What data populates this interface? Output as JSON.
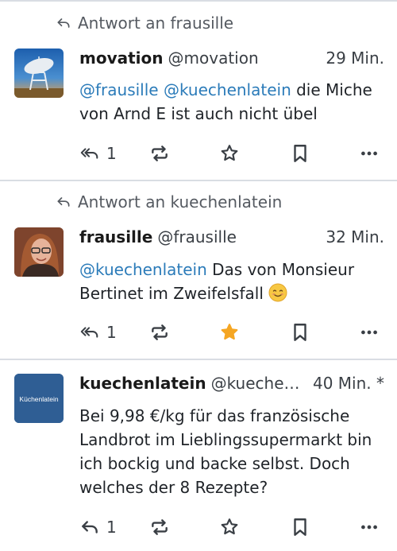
{
  "posts": [
    {
      "reply_to": "Antwort an frausille",
      "display_name": "movation",
      "handle": "@movation",
      "time": "29 Min.",
      "content_mentions": "@frausille @kuechenlatein",
      "content_text": " die Miche von Arnd E ist auch nicht übel",
      "reply_count": "1",
      "favourited": false,
      "avatar_icon": "satellite-dish"
    },
    {
      "reply_to": "Antwort an kuechenlatein",
      "display_name": "frausille",
      "handle": "@frausille",
      "time": "32 Min.",
      "content_mentions": "@kuechenlatein",
      "content_text": " Das von Monsieur Bertinet im Zweifelsfall",
      "content_emoji": "smiling-face",
      "reply_count": "1",
      "favourited": true,
      "avatar_icon": "person-photo"
    },
    {
      "display_name": "kuechenlatein",
      "handle": "@kuechenl…",
      "time": "40 Min. *",
      "content_text": "Bei 9,98 €/kg für das französische Landbrot im Lieblingssupermarkt bin ich bockig und backe selbst. Doch welches der 8 Rezepte?",
      "reply_count": "1",
      "favourited": false,
      "avatar_label": "Küchenlatein"
    }
  ],
  "colors": {
    "mention": "#2b7bb9",
    "star_active": "#f5a623",
    "avatar3_bg": "#2f5e94"
  }
}
